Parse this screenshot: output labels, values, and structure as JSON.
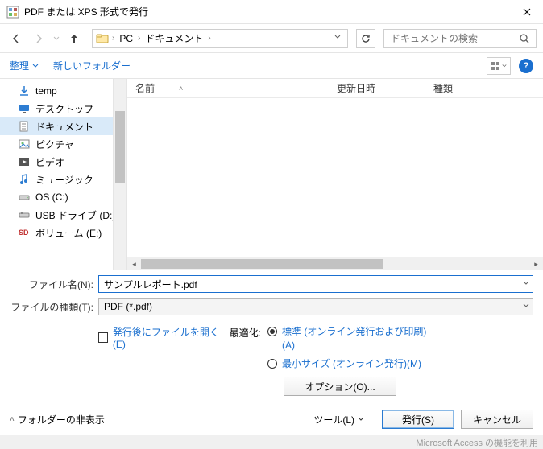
{
  "window": {
    "title": "PDF または XPS 形式で発行"
  },
  "nav": {
    "path_root": "PC",
    "path_folder": "ドキュメント",
    "search_placeholder": "ドキュメントの検索"
  },
  "toolbar": {
    "organize": "整理",
    "new_folder": "新しいフォルダー"
  },
  "tree": {
    "items": [
      {
        "label": "temp",
        "icon": "download"
      },
      {
        "label": "デスクトップ",
        "icon": "desktop"
      },
      {
        "label": "ドキュメント",
        "icon": "document",
        "selected": true
      },
      {
        "label": "ピクチャ",
        "icon": "pictures"
      },
      {
        "label": "ビデオ",
        "icon": "videos"
      },
      {
        "label": "ミュージック",
        "icon": "music"
      },
      {
        "label": "OS (C:)",
        "icon": "drive"
      },
      {
        "label": "USB ドライブ (D:)",
        "icon": "usb"
      },
      {
        "label": "ボリューム (E:)",
        "icon": "sd"
      }
    ]
  },
  "columns": {
    "name": "名前",
    "date": "更新日時",
    "type": "種類"
  },
  "fields": {
    "filename_label": "ファイル名(N):",
    "filename_value": "サンプルレポート.pdf",
    "filetype_label": "ファイルの種類(T):",
    "filetype_value": "PDF (*.pdf)"
  },
  "options": {
    "open_after": "発行後にファイルを開く(E)",
    "optimize_label": "最適化:",
    "standard": "標準 (オンライン発行および印刷)(A)",
    "minimum": "最小サイズ (オンライン発行)(M)",
    "options_btn": "オプション(O)..."
  },
  "footer": {
    "hide_folders": "フォルダーの非表示",
    "tools": "ツール(L)",
    "publish": "発行(S)",
    "cancel": "キャンセル"
  },
  "status": {
    "text": "Microsoft Access の機能を利用"
  }
}
